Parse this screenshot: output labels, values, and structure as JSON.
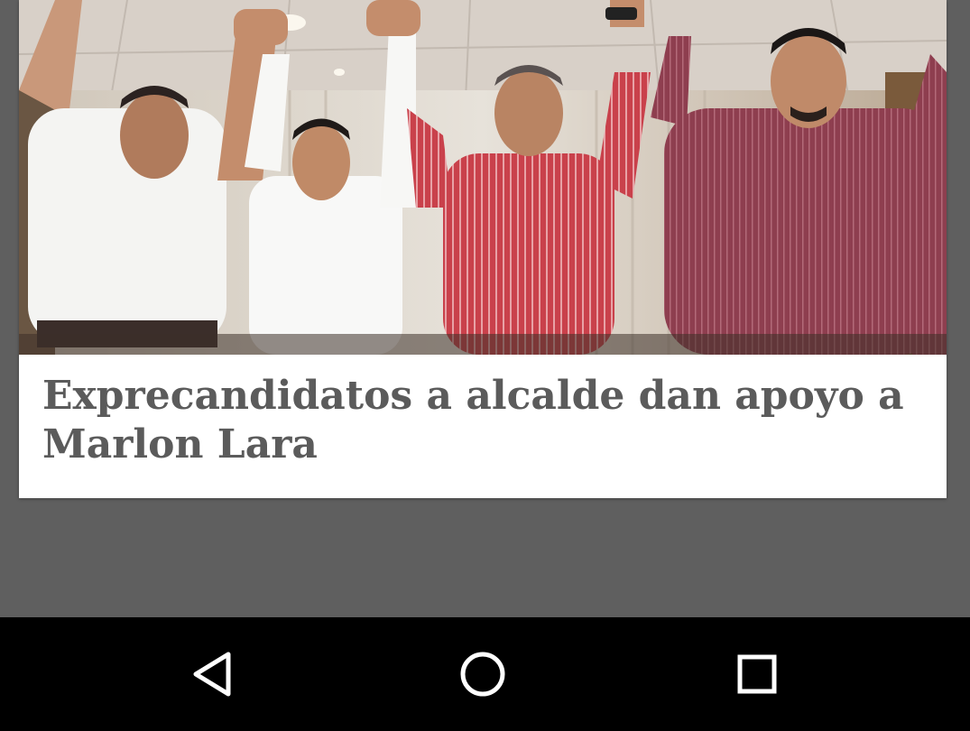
{
  "article": {
    "image_alt": "Four men holding raised, joined hands on a stage",
    "title": "Exprecandidatos a alcalde dan apoyo a Marlon Lara"
  },
  "navigation_bar": {
    "buttons": [
      {
        "name": "back",
        "icon": "back-triangle-icon"
      },
      {
        "name": "home",
        "icon": "home-circle-icon"
      },
      {
        "name": "recent-apps",
        "icon": "recent-apps-square-icon"
      }
    ]
  },
  "colors": {
    "background": "#5f5f5f",
    "card": "#ffffff",
    "title_text": "#5b5b5b",
    "navbar": "#000000",
    "nav_icon": "#ffffff"
  }
}
